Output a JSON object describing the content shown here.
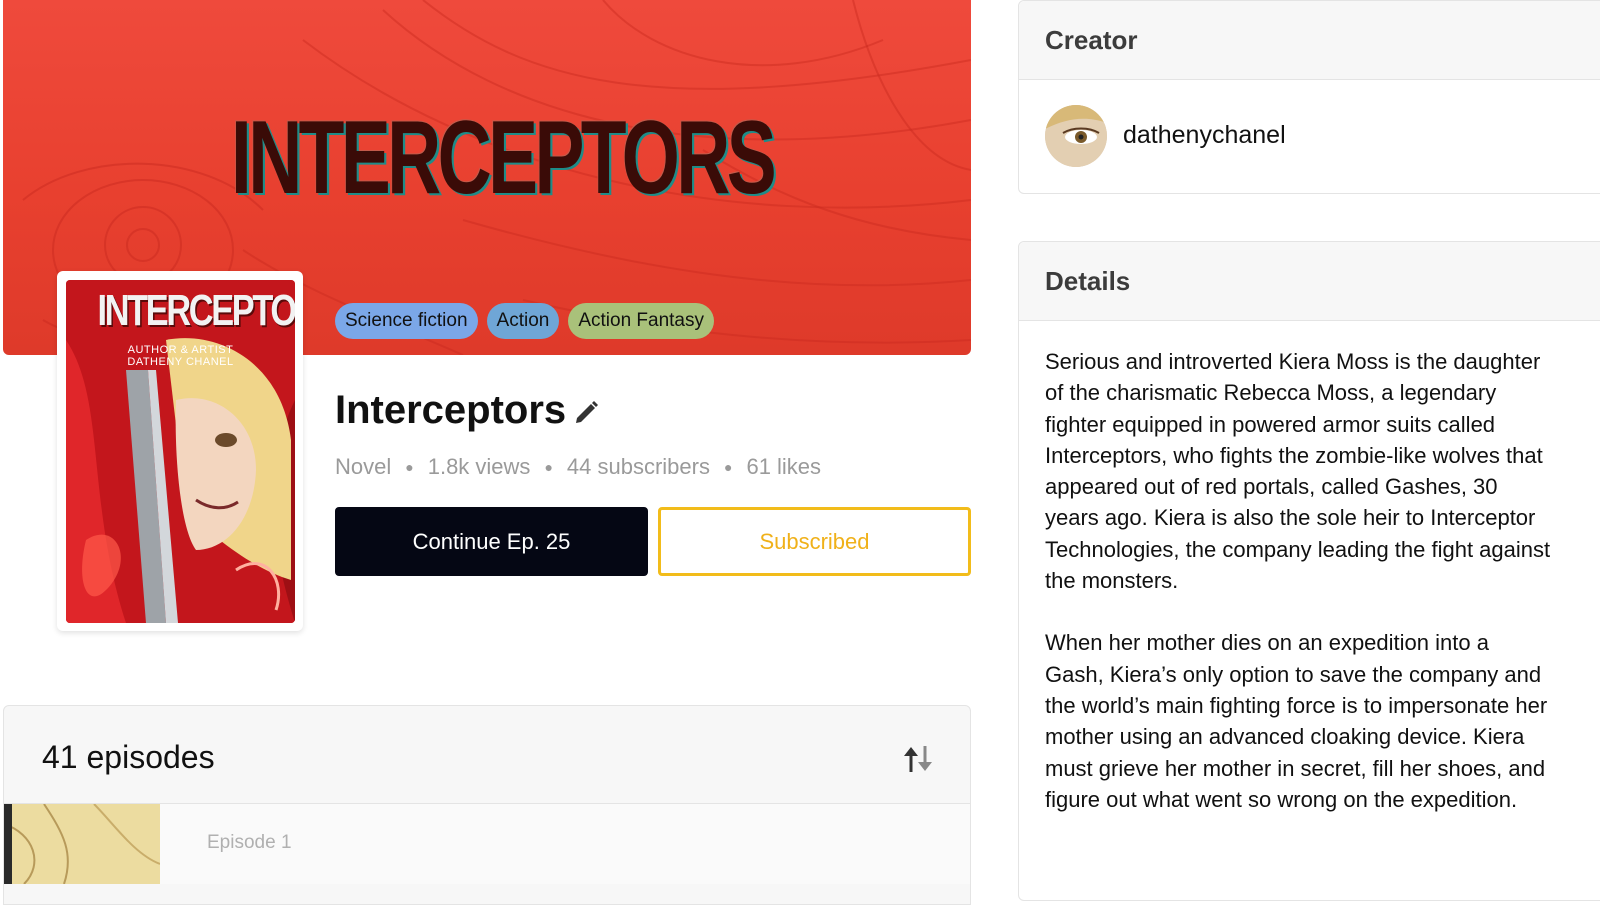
{
  "banner": {
    "title": "INTERCEPTORS"
  },
  "cover": {
    "title": "INTERCEPTORS",
    "subtitle": "AUTHOR & ARTIST",
    "author": "DATHENY CHANEL"
  },
  "tags": [
    "Science fiction",
    "Action",
    "Action Fantasy"
  ],
  "series": {
    "title": "Interceptors",
    "type": "Novel",
    "views": "1.8k views",
    "subscribers": "44 subscribers",
    "likes": "61 likes"
  },
  "actions": {
    "continue_label": "Continue Ep. 25",
    "subscribed_label": "Subscribed"
  },
  "episodes": {
    "count_label": "41 episodes",
    "rows": [
      {
        "label": "Episode 1"
      }
    ]
  },
  "creator": {
    "heading": "Creator",
    "name": "dathenychanel"
  },
  "details": {
    "heading": "Details",
    "paragraphs": [
      "Serious and introverted Kiera Moss is the daughter of the charismatic Rebecca Moss, a legendary fighter equipped in powered armor suits called Interceptors, who fights the zombie-like wolves that appeared out of red portals, called Gashes, 30 years ago. Kiera is also the sole heir to Interceptor Technologies, the company leading the fight against the monsters.",
      "When her mother dies on an expedition into a Gash, Kiera’s only option to save the company and the world’s main fighting force is to impersonate her mother using an advanced cloaking device. Kiera must grieve her mother in secret, fill her shoes, and figure out what went so wrong on the expedition."
    ]
  },
  "colors": {
    "banner_red": "#e8402f",
    "continue_bg": "#050714",
    "subscribed_accent": "#f2bc1a",
    "tag_scifi": "#7ba7e8",
    "tag_action": "#6fa6d6",
    "tag_fantasy": "#a9c17a"
  },
  "icons": {
    "edit": "pencil-icon",
    "sort": "sort-icon"
  }
}
